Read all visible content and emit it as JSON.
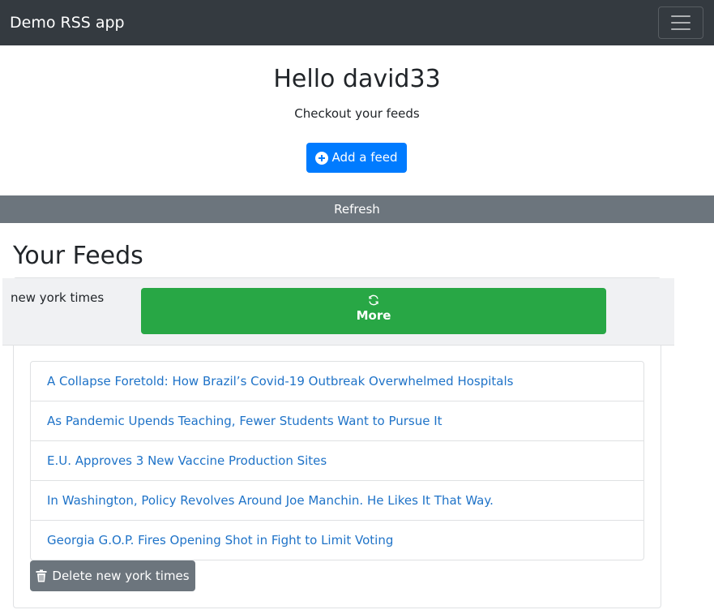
{
  "navbar": {
    "brand": "Demo RSS app",
    "toggler_icon": "hamburger-menu-icon"
  },
  "hero": {
    "greeting": "Hello david33",
    "subtitle": "Checkout your feeds",
    "add_feed_label": "Add a feed",
    "add_feed_icon": "plus-circle-icon"
  },
  "refresh_label": "Refresh",
  "feeds_heading": "Your Feeds",
  "feeds": [
    {
      "name": "new york times",
      "more_label": "More",
      "more_icon": "refresh-icon",
      "articles": [
        "A Collapse Foretold: How Brazil’s Covid-19 Outbreak Overwhelmed Hospitals",
        "As Pandemic Upends Teaching, Fewer Students Want to Pursue It",
        "E.U. Approves 3 New Vaccine Production Sites",
        "In Washington, Policy Revolves Around Joe Manchin. He Likes It That Way.",
        "Georgia G.O.P. Fires Opening Shot in Fight to Limit Voting"
      ],
      "delete_label": "Delete new york times",
      "delete_icon": "trash-icon"
    }
  ],
  "colors": {
    "navbar": "#343a40",
    "primary": "#007bff",
    "secondary": "#6c757d",
    "success": "#28a745",
    "link": "#1f73c8"
  }
}
